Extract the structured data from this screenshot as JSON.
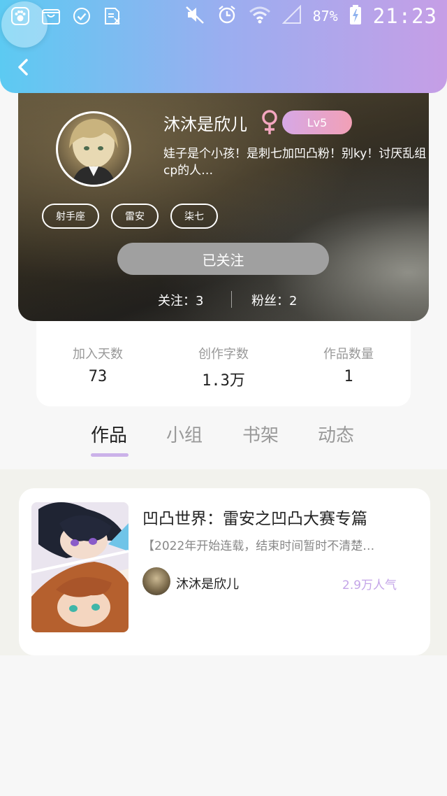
{
  "status_bar": {
    "battery_percent": "87%",
    "time": "21:23",
    "icons": [
      "floating-ball-icon",
      "paw-icon",
      "bag-icon",
      "check-circle-icon",
      "excel-icon",
      "mute-icon",
      "alarm-icon",
      "wifi-icon",
      "signal-icon",
      "battery-charging-icon"
    ]
  },
  "header": {
    "back_icon": "chevron-left-icon"
  },
  "profile": {
    "nickname": "沐沐是欣儿",
    "gender_symbol": "♀",
    "level": "Lv5",
    "bio": "娃子是个小孩！是刺七加凹凸粉！别ky！讨厌乱组cp的人…",
    "tags": [
      "射手座",
      "雷安",
      "柒七"
    ],
    "follow_button": "已关注",
    "following": "关注：3",
    "fans": "粉丝：2"
  },
  "stats": [
    {
      "label": "加入天数",
      "value": "73"
    },
    {
      "label": "创作字数",
      "value": "1.3万"
    },
    {
      "label": "作品数量",
      "value": "1"
    }
  ],
  "tabs": [
    "作品",
    "小组",
    "书架",
    "动态"
  ],
  "active_tab": "作品",
  "works": [
    {
      "title": "凹凸世界：雷安之凹凸大赛专篇",
      "description": "【2022年开始连载，结束时间暂时不清楚…",
      "author": "沐沐是欣儿",
      "popularity": "2.9万人气"
    }
  ],
  "colors": {
    "header_gradient_start": "#5ccaf2",
    "header_gradient_end": "#c69ee6",
    "level_badge_start": "#d6a8e6",
    "level_badge_end": "#f2a0b6",
    "gender_color": "#f4a7c0",
    "tab_underline": "#cbb1e9",
    "popularity_color": "#c4a5e8",
    "follow_button_bg": "#a0a0a0"
  }
}
